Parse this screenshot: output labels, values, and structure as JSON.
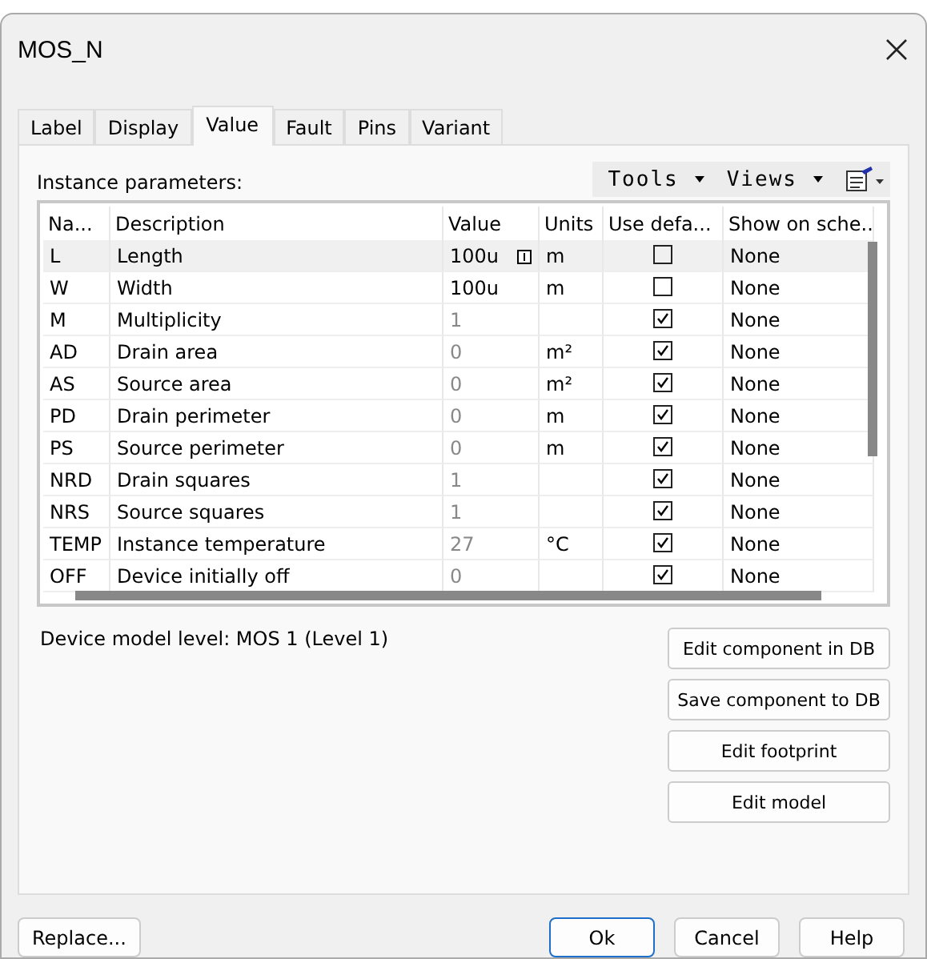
{
  "window": {
    "title": "MOS_N"
  },
  "tabs": [
    {
      "label": "Label",
      "selected": false
    },
    {
      "label": "Display",
      "selected": false
    },
    {
      "label": "Value",
      "selected": true
    },
    {
      "label": "Fault",
      "selected": false
    },
    {
      "label": "Pins",
      "selected": false
    },
    {
      "label": "Variant",
      "selected": false
    }
  ],
  "section_label": "Instance parameters:",
  "toolbar": {
    "tools": "Tools",
    "views": "Views"
  },
  "table": {
    "columns": [
      "Na...",
      "Description",
      "Value",
      "Units",
      "Use defa...",
      "Show on sche.."
    ],
    "rows": [
      {
        "name": "L",
        "description": "Length",
        "value": "100u",
        "units": "m",
        "use_default": false,
        "show": "None",
        "selected": true
      },
      {
        "name": "W",
        "description": "Width",
        "value": "100u",
        "units": "m",
        "use_default": false,
        "show": "None",
        "selected": false
      },
      {
        "name": "M",
        "description": "Multiplicity",
        "value": "1",
        "units": "",
        "use_default": true,
        "show": "None",
        "selected": false
      },
      {
        "name": "AD",
        "description": "Drain area",
        "value": "0",
        "units": "m²",
        "use_default": true,
        "show": "None",
        "selected": false
      },
      {
        "name": "AS",
        "description": "Source area",
        "value": "0",
        "units": "m²",
        "use_default": true,
        "show": "None",
        "selected": false
      },
      {
        "name": "PD",
        "description": "Drain perimeter",
        "value": "0",
        "units": "m",
        "use_default": true,
        "show": "None",
        "selected": false
      },
      {
        "name": "PS",
        "description": "Source perimeter",
        "value": "0",
        "units": "m",
        "use_default": true,
        "show": "None",
        "selected": false
      },
      {
        "name": "NRD",
        "description": "Drain squares",
        "value": "1",
        "units": "",
        "use_default": true,
        "show": "None",
        "selected": false
      },
      {
        "name": "NRS",
        "description": "Source squares",
        "value": "1",
        "units": "",
        "use_default": true,
        "show": "None",
        "selected": false
      },
      {
        "name": "TEMP",
        "description": "Instance temperature",
        "value": "27",
        "units": "°C",
        "use_default": true,
        "show": "None",
        "selected": false
      },
      {
        "name": "OFF",
        "description": "Device initially off",
        "value": "0",
        "units": "",
        "use_default": true,
        "show": "None",
        "selected": false
      }
    ]
  },
  "model_level": "Device model level: MOS 1 (Level 1)",
  "side_buttons": [
    "Edit component in DB",
    "Save component to DB",
    "Edit footprint",
    "Edit model"
  ],
  "footer": {
    "replace": "Replace...",
    "buttons": [
      {
        "label": "Ok",
        "default": true
      },
      {
        "label": "Cancel",
        "default": false
      },
      {
        "label": "Help",
        "default": false
      }
    ]
  }
}
